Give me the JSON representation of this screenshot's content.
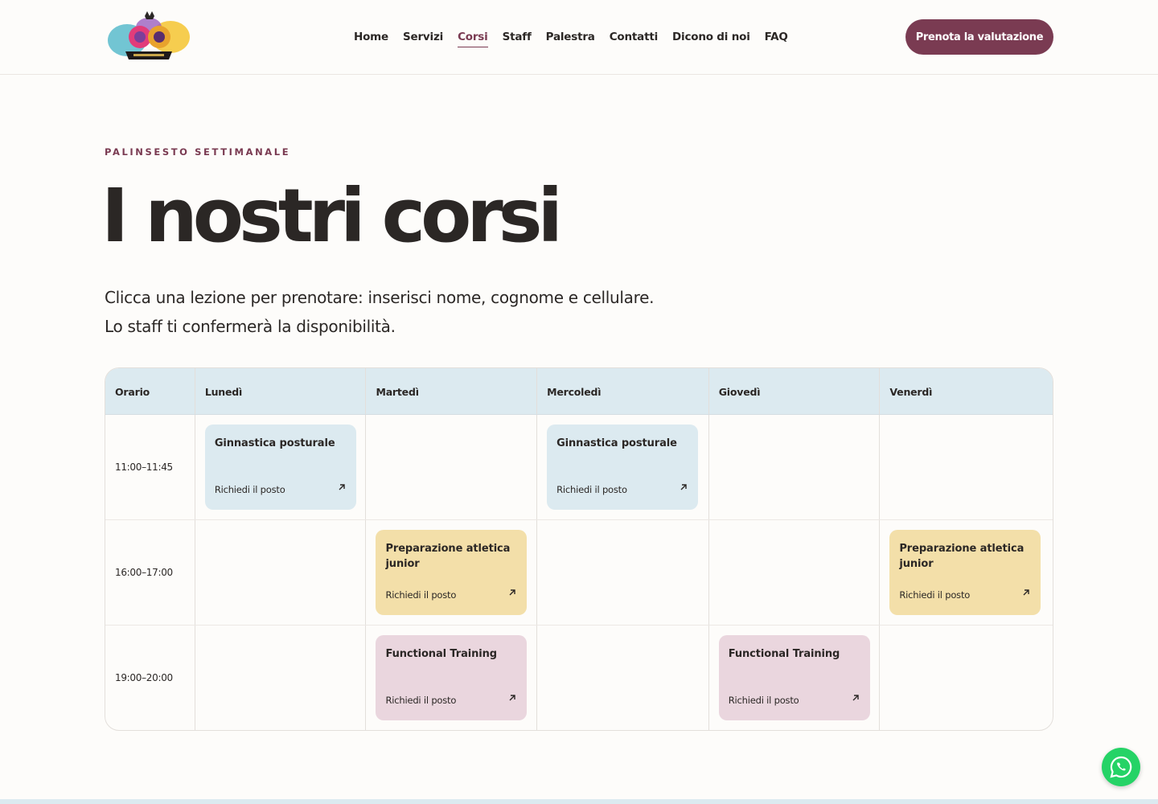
{
  "header": {
    "logo_icon": "gym-crest-logo",
    "nav": [
      {
        "label": "Home",
        "active": false
      },
      {
        "label": "Servizi",
        "active": false
      },
      {
        "label": "Corsi",
        "active": true
      },
      {
        "label": "Staff",
        "active": false
      },
      {
        "label": "Palestra",
        "active": false
      },
      {
        "label": "Contatti",
        "active": false
      },
      {
        "label": "Dicono di noi",
        "active": false
      },
      {
        "label": "FAQ",
        "active": false
      }
    ],
    "cta_label": "Prenota la valutazione"
  },
  "hero": {
    "eyebrow": "PALINSESTO SETTIMANALE",
    "title": "I nostri corsi",
    "subtitle_line1": "Clicca una lezione per prenotare: inserisci nome, cognome e cellulare.",
    "subtitle_line2": "Lo staff ti confermerà la disponibilità."
  },
  "schedule": {
    "headers": [
      "Orario",
      "Lunedì",
      "Martedì",
      "Mercoledì",
      "Giovedì",
      "Venerdì"
    ],
    "rows": [
      {
        "time": "11:00–11:45"
      },
      {
        "time": "16:00–17:00"
      },
      {
        "time": "19:00–20:00"
      }
    ],
    "courses": {
      "ginnastica": "Ginnastica posturale",
      "prep_line1": "Preparazione atletica",
      "prep_line2": "junior",
      "functional": "Functional Training"
    },
    "action_label": "Richiedi il posto"
  },
  "colors": {
    "accent": "#7a3b52",
    "blue_card": "#dceaf0",
    "yellow_card": "#f3dfa9",
    "pink_card": "#ead6de",
    "whatsapp": "#25d366"
  },
  "whatsapp_icon": "whatsapp-icon"
}
